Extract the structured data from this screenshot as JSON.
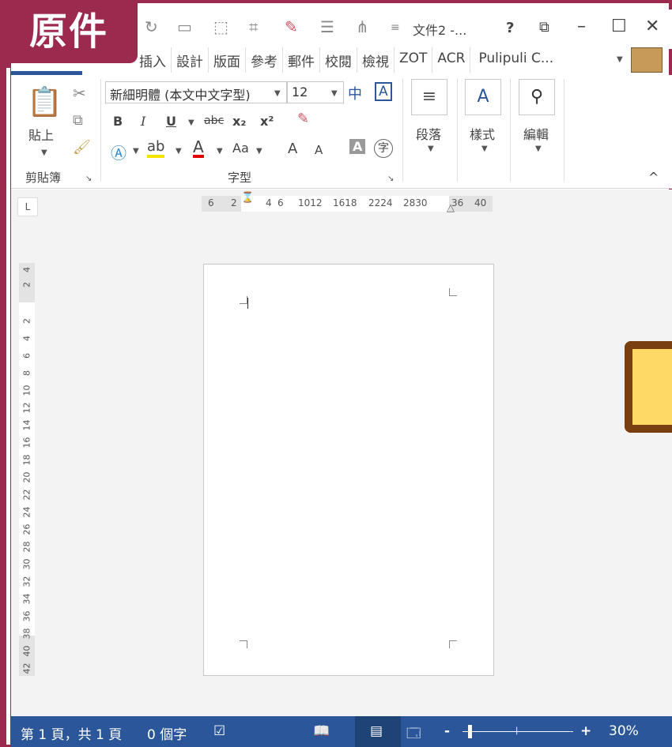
{
  "badge": "原件",
  "titlebar": {
    "title": "文件2 -...",
    "help": "?",
    "ribbon_display": "⧉",
    "minimize": "–",
    "maximize": "☐",
    "close": "✕",
    "qa_icons": [
      "redo-icon",
      "screen-icon",
      "new-doc-icon",
      "crop-icon",
      "eraser-icon",
      "align-icon",
      "distribute-icon",
      "customize-icon"
    ]
  },
  "tabs": [
    "插入",
    "設計",
    "版面",
    "參考",
    "郵件",
    "校閱",
    "檢視",
    "ZOT",
    "ACR",
    "Pulipuli C..."
  ],
  "ribbon": {
    "paste_label": "貼上",
    "clipboard_group": "剪貼簿",
    "font_name": "新細明體 (本文中文字型)",
    "font_size": "12",
    "bold": "B",
    "italic": "I",
    "underline": "U",
    "strike": "abc",
    "subscript": "x₂",
    "superscript": "x²",
    "font_color": "A",
    "change_case": "Aa",
    "grow_font": "A",
    "shrink_font": "A",
    "shade": "A",
    "enclose": "字",
    "phonetic": "中",
    "char_border": "A",
    "font_group": "字型",
    "paragraph_label": "段落",
    "styles_label": "樣式",
    "editing_label": "編輯",
    "collapse": "^"
  },
  "ruler": {
    "corner": "L",
    "h_labels": [
      "6",
      "2",
      "4",
      "6",
      "1012",
      "1618",
      "2224",
      "2830",
      "36",
      "40"
    ],
    "v_labels": [
      "4",
      "2",
      "2",
      "4",
      "6",
      "8",
      "10",
      "12",
      "14",
      "16",
      "18",
      "20",
      "22",
      "24",
      "26",
      "28",
      "30",
      "32",
      "34",
      "36",
      "38",
      "40",
      "42"
    ]
  },
  "statusbar": {
    "page": "第 1 頁，共 1 頁",
    "words": "0 個字",
    "zoom": "30%",
    "zoom_minus": "-",
    "zoom_plus": "+"
  },
  "colors": {
    "accent": "#9c2a4e",
    "word_blue": "#2b579a",
    "callout_fill": "#ffd966",
    "callout_border": "#7a3f10"
  }
}
